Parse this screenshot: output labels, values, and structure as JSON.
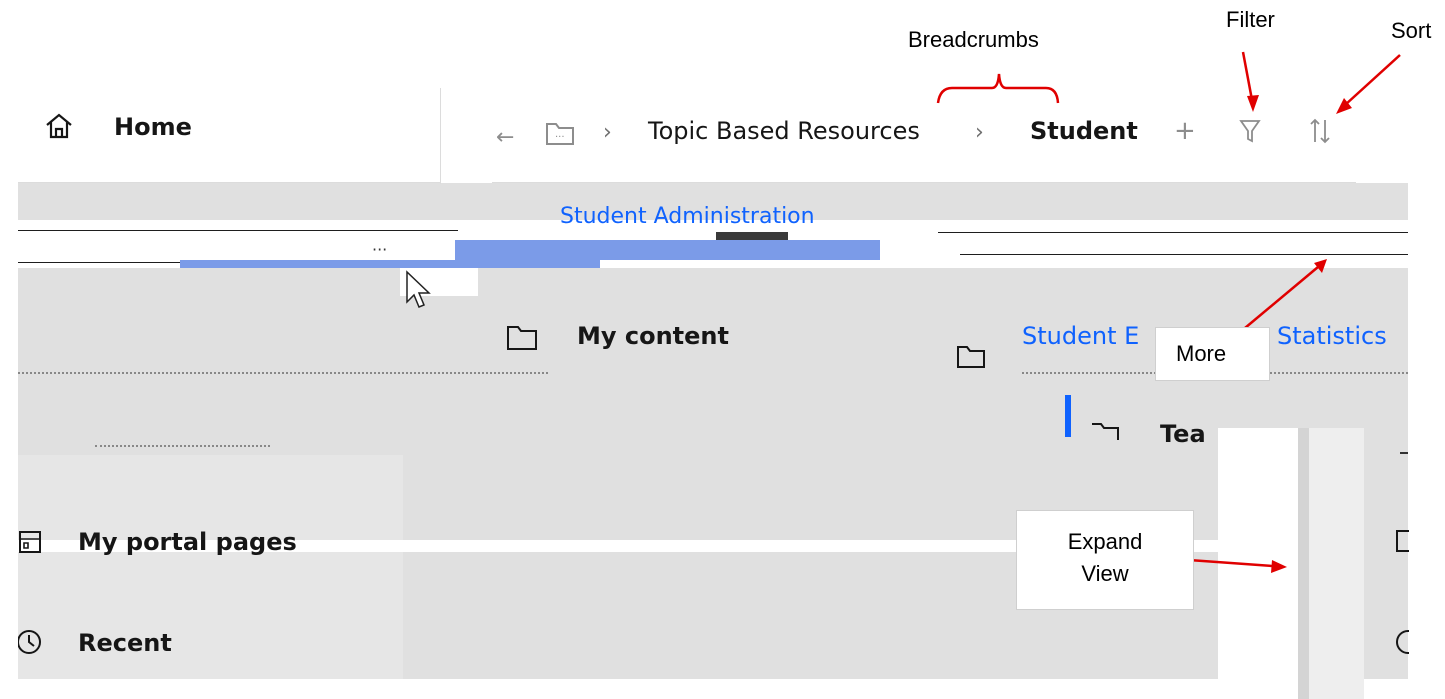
{
  "annotations": {
    "breadcrumbs": "Breadcrumbs",
    "filter": "Filter",
    "sort": "Sort",
    "more": "More",
    "expand_view": "Expand View"
  },
  "sidebar": {
    "home": "Home",
    "my_content": "My content",
    "my_portal_pages": "My portal pages",
    "recent": "Recent"
  },
  "breadcrumb": {
    "items": [
      "Topic Based Resources",
      "Student"
    ]
  },
  "content": {
    "row1_title": "Student Administration",
    "row2_title_a": "Student E",
    "row2_title_b": "Statistics",
    "row3_partial": "Tea"
  },
  "colors": {
    "link": "#0f62fe",
    "annotation_arrow": "#e00000",
    "panel_gray": "#e0e0e0"
  }
}
